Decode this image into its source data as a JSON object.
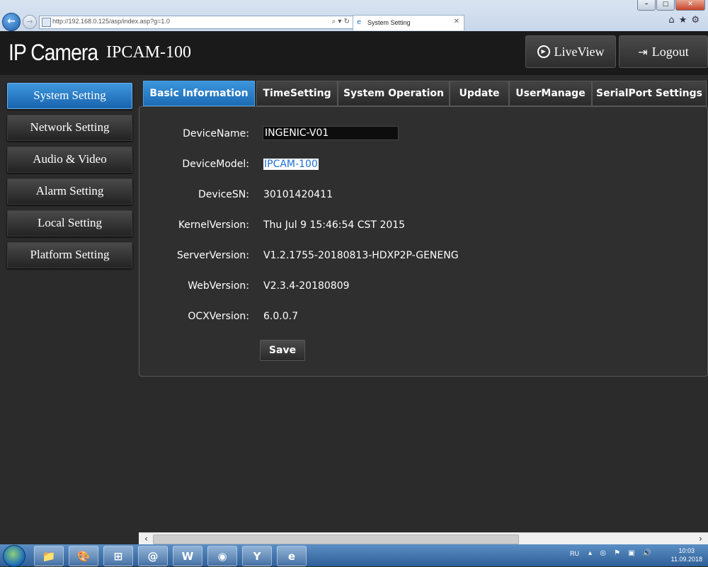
{
  "browser": {
    "address": "http://192.168.0.125/asp/index.asp?g=1.0",
    "tab_title": "System Setting"
  },
  "header": {
    "app_title": "IP Camera",
    "model": "IPCAM-100",
    "liveview_label": "LiveView",
    "logout_label": "Logout"
  },
  "sidebar": {
    "items": [
      {
        "label": "System Setting",
        "active": true
      },
      {
        "label": "Network Setting",
        "active": false
      },
      {
        "label": "Audio & Video",
        "active": false
      },
      {
        "label": "Alarm Setting",
        "active": false
      },
      {
        "label": "Local Setting",
        "active": false
      },
      {
        "label": "Platform Setting",
        "active": false
      }
    ]
  },
  "tabs": [
    {
      "label": "Basic Information",
      "active": true
    },
    {
      "label": "TimeSetting",
      "active": false
    },
    {
      "label": "System Operation",
      "active": false
    },
    {
      "label": "Update",
      "active": false
    },
    {
      "label": "UserManage",
      "active": false
    },
    {
      "label": "SerialPort Settings",
      "active": false
    }
  ],
  "fields": {
    "device_name": {
      "label": "DeviceName:",
      "value": "INGENIC-V01"
    },
    "device_model": {
      "label": "DeviceModel:",
      "value": "IPCAM-100"
    },
    "device_sn": {
      "label": "DeviceSN:",
      "value": "30101420411"
    },
    "kernel_version": {
      "label": "KernelVersion:",
      "value": "Thu Jul 9 15:46:54 CST 2015"
    },
    "server_version": {
      "label": "ServerVersion:",
      "value": "V1.2.1755-20180813-HDXP2P-GENENG"
    },
    "web_version": {
      "label": "WebVersion:",
      "value": "V2.3.4-20180809"
    },
    "ocx_version": {
      "label": "OCXVersion:",
      "value": "6.0.0.7"
    }
  },
  "save_label": "Save",
  "taskbar": {
    "apps": [
      "file-explorer-icon",
      "paint-icon",
      "windows-flag-icon",
      "at-mail-icon",
      "word-icon",
      "firefox-icon",
      "yandex-icon",
      "internet-explorer-icon"
    ],
    "language": "RU",
    "time": "10:03",
    "date": "11.09.2018"
  },
  "colors": {
    "accent": "#1d6bb5",
    "background": "#2b2b2b",
    "header": "#1a1a1a",
    "selection": "#1f6fd1"
  }
}
